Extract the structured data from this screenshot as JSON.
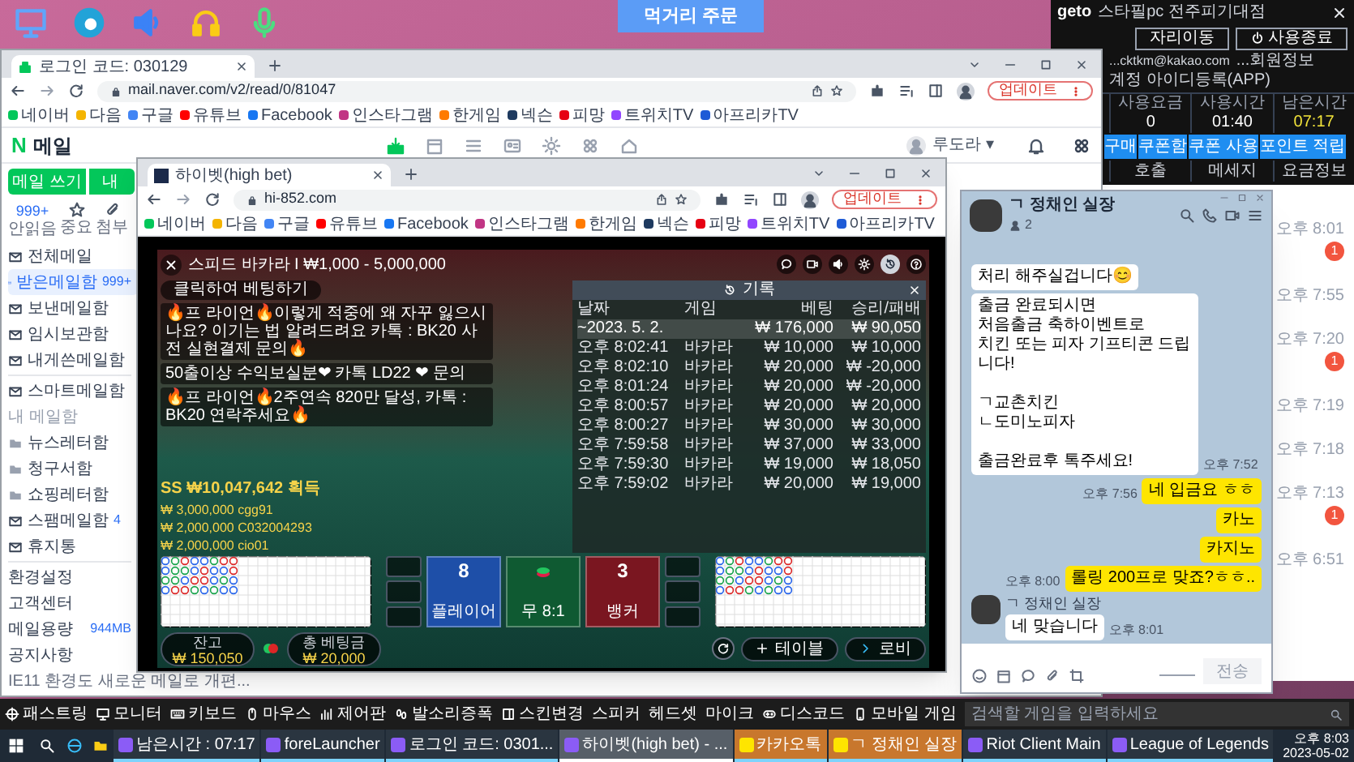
{
  "desktop_button": "먹거리 주문",
  "geto": {
    "logo": "geto",
    "title": "스타필pc 전주피기대점",
    "buttons": [
      "자리이동",
      "사용종료"
    ],
    "account": "...cktkm@kakao.com",
    "links": [
      "...회원정보",
      "계정 아이디등록(APP)"
    ],
    "stats": [
      {
        "label": "사용요금",
        "value": "0",
        "highlight": false
      },
      {
        "label": "사용시간",
        "value": "01:40",
        "highlight": false
      },
      {
        "label": "남은시간",
        "value": "07:17",
        "highlight": true
      }
    ],
    "actions": [
      "구매",
      "쿠폰함",
      "쿠폰 사용",
      "포인트 적립"
    ],
    "tabs": [
      "호출",
      "메세지",
      "요금정보"
    ]
  },
  "kakao_list": [
    {
      "time": "오후 8:01",
      "unread": "1"
    },
    {
      "time": "오후 7:55"
    },
    {
      "time": "오후 7:20",
      "unread": "1"
    },
    {
      "time": "오후 7:19"
    },
    {
      "time": "오후 7:18"
    },
    {
      "time": "오후 7:13",
      "unread": "1"
    },
    {
      "time": "오후 6:51"
    }
  ],
  "mail_browser": {
    "tab": "로그인 코드: 030129",
    "url": "mail.naver.com/v2/read/0/81047",
    "update_button": "업데이트",
    "bookmarks": [
      {
        "label": "네이버",
        "color": "#03c75a"
      },
      {
        "label": "다음",
        "color": "#f4b400"
      },
      {
        "label": "구글",
        "color": "#4285f4"
      },
      {
        "label": "유튜브",
        "color": "#ff0000"
      },
      {
        "label": "Facebook",
        "color": "#1877f2"
      },
      {
        "label": "인스타그램",
        "color": "#c13584"
      },
      {
        "label": "한게임",
        "color": "#ff7a00"
      },
      {
        "label": "넥슨",
        "color": "#1e3a5f"
      },
      {
        "label": "피망",
        "color": "#e60012"
      },
      {
        "label": "트위치TV",
        "color": "#9146ff"
      },
      {
        "label": "아프리카TV",
        "color": "#1f5bd6"
      }
    ],
    "logo": "N",
    "app_title": "메일",
    "user": "루도라 ▾",
    "compose_button": "메일 쓰기",
    "second_button": "내",
    "quick": [
      {
        "count": "999+",
        "label": "안읽음"
      },
      {
        "label": "중요"
      },
      {
        "label": "첨부"
      }
    ],
    "folders": [
      {
        "kind": "mailbox",
        "label": "전체메일",
        "selected": false
      },
      {
        "kind": "mailbox",
        "label": "받은메일함",
        "count": "999+",
        "selected": true
      },
      {
        "kind": "mailbox",
        "label": "보낸메일함",
        "selected": false
      },
      {
        "kind": "mailbox",
        "label": "임시보관함",
        "selected": false
      },
      {
        "kind": "mailbox",
        "label": "내게쓴메일함",
        "selected": false
      },
      {
        "kind": "mailbox",
        "label": "스마트메일함",
        "selected": false
      },
      {
        "kind": "header",
        "label": "내 메일함",
        "selected": false
      },
      {
        "kind": "folder",
        "label": "뉴스레터함",
        "selected": false
      },
      {
        "kind": "folder",
        "label": "청구서함",
        "selected": false
      },
      {
        "kind": "folder",
        "label": "쇼핑레터함",
        "selected": false
      },
      {
        "kind": "mailbox",
        "label": "스팸메일함",
        "count": "4",
        "selected": false
      },
      {
        "kind": "mailbox",
        "label": "휴지통",
        "selected": false
      },
      {
        "kind": "link",
        "label": "환경설정",
        "selected": false
      },
      {
        "kind": "link",
        "label": "고객센터",
        "selected": false
      },
      {
        "kind": "usage",
        "label": "메일용량",
        "value": "944MB",
        "selected": false
      },
      {
        "kind": "link",
        "label": "공지사항",
        "selected": false
      },
      {
        "kind": "notice",
        "label": "IE11 환경도 새로운 메일로 개편...",
        "selected": false
      }
    ]
  },
  "game_browser": {
    "tab": "하이벳(high bet)",
    "url": "hi-852.com",
    "update_button": "업데이트",
    "bookmarks": [
      {
        "label": "네이버",
        "color": "#03c75a"
      },
      {
        "label": "다음",
        "color": "#f4b400"
      },
      {
        "label": "구글",
        "color": "#4285f4"
      },
      {
        "label": "유튜브",
        "color": "#ff0000"
      },
      {
        "label": "Facebook",
        "color": "#1877f2"
      },
      {
        "label": "인스타그램",
        "color": "#c13584"
      },
      {
        "label": "한게임",
        "color": "#ff7a00"
      },
      {
        "label": "넥슨",
        "color": "#1e3a5f"
      },
      {
        "label": "피망",
        "color": "#e60012"
      },
      {
        "label": "트위치TV",
        "color": "#9146ff"
      },
      {
        "label": "아프리카TV",
        "color": "#1f5bd6"
      }
    ],
    "game": {
      "title": "스피드 바카라 I ₩1,000 - 5,000,000",
      "bet_prompt": "클릭하여 베팅하기",
      "chat": [
        "🔥프 라이언🔥이렇게 적중에 왜 자꾸 잃으시나요? 이기는 법 알려드려요 카톡 : BK20 사전 실현결제 문의🔥",
        "50출이상 수익보실분❤ 카톡 LD22 ❤ 문의",
        "🔥프 라이언🔥2주연속 820만 달성, 카톡 : BK20 연락주세요🔥"
      ],
      "history": {
        "title": "기록",
        "columns": [
          "날짜",
          "게임",
          "베팅",
          "승리/패배"
        ],
        "rows": [
          {
            "kind": "summary",
            "cells": [
              "~2023. 5. 2.",
              "",
              "₩ 176,000",
              "₩ 90,050"
            ]
          },
          {
            "kind": "entry",
            "cells": [
              "오후 8:02:41",
              "바카라",
              "₩ 10,000",
              "₩ 10,000"
            ]
          },
          {
            "kind": "entry",
            "cells": [
              "오후 8:02:10",
              "바카라",
              "₩ 20,000",
              "₩ -20,000"
            ]
          },
          {
            "kind": "entry",
            "cells": [
              "오후 8:01:24",
              "바카라",
              "₩ 20,000",
              "₩ -20,000"
            ]
          },
          {
            "kind": "entry",
            "cells": [
              "오후 8:00:57",
              "바카라",
              "₩ 20,000",
              "₩ 20,000"
            ]
          },
          {
            "kind": "entry",
            "cells": [
              "오후 8:00:27",
              "바카라",
              "₩ 30,000",
              "₩ 30,000"
            ]
          },
          {
            "kind": "entry",
            "cells": [
              "오후 7:59:58",
              "바카라",
              "₩ 37,000",
              "₩ 33,000"
            ]
          },
          {
            "kind": "entry",
            "cells": [
              "오후 7:59:30",
              "바카라",
              "₩ 19,000",
              "₩ 18,050"
            ]
          },
          {
            "kind": "entry",
            "cells": [
              "오후 7:59:02",
              "바카라",
              "₩ 20,000",
              "₩ 19,000"
            ]
          }
        ]
      },
      "winner": "SS ₩10,047,642 획득",
      "winners": [
        "₩ 3,000,000 cgg91",
        "₩ 2,000,000 C032004293",
        "₩ 2,000,000 cio01"
      ],
      "bet_spots": [
        {
          "label": "플레이어",
          "score": "8",
          "color": "#1e4fa8"
        },
        {
          "label": "무 8:1",
          "color": "#0f5a32"
        },
        {
          "label": "뱅커",
          "score": "3",
          "color": "#7a1620"
        }
      ],
      "balance": {
        "label": "잔고",
        "value": "₩ 150,050"
      },
      "total_bet": {
        "label": "총 베팅금",
        "value": "₩ 20,000"
      },
      "table_button": "테이블",
      "lobby_button": "로비"
    }
  },
  "chat": {
    "name": "ㄱ 정채인 실장",
    "members": "2",
    "send_button": "전송",
    "messages": [
      {
        "kind": "received",
        "text": "처리 해주실겁니다😊"
      },
      {
        "kind": "received",
        "text": "출금 완료되시면\n처음출금 축하이벤트로\n치킨 또는 피자 기프티콘 드립니다!\n\nㄱ교촌치킨\nㄴ도미노피자\n\n출금완료후 톡주세요!",
        "time": "오후 7:52"
      },
      {
        "kind": "sent",
        "text": "네 입금요 ㅎㅎ",
        "time": "오후 7:56"
      },
      {
        "kind": "sent",
        "text": "카노"
      },
      {
        "kind": "sent",
        "text": "카지노"
      },
      {
        "kind": "sent",
        "text": "롤링 200프로 맞죠?ㅎㅎ..",
        "time": "오후 8:00"
      },
      {
        "kind": "received",
        "sender": "ㄱ 정채인 실장",
        "text": "네 맞습니다",
        "time": "오후 8:01"
      }
    ]
  },
  "launcher": {
    "items": [
      "패스트링",
      "모니터",
      "키보드",
      "마우스",
      "제어판",
      "발소리증폭",
      "스킨변경",
      "스피커",
      "헤드셋",
      "마이크",
      "디스코드",
      "모바일 게임"
    ],
    "search_placeholder": "검색할 게임을 입력하세요"
  },
  "taskbar": {
    "items": [
      {
        "label": "남은시간 : 07:17",
        "selected": false,
        "flashing": false
      },
      {
        "label": "foreLauncher",
        "selected": false,
        "flashing": false
      },
      {
        "label": "로그인 코드: 0301...",
        "selected": false,
        "flashing": false
      },
      {
        "label": "하이벳(high bet) - ...",
        "selected": true,
        "flashing": false
      },
      {
        "label": "카카오톡",
        "selected": false,
        "flashing": true
      },
      {
        "label": "ㄱ 정채인 실장",
        "selected": false,
        "flashing": true
      },
      {
        "label": "Riot Client Main",
        "selected": false,
        "flashing": false
      },
      {
        "label": "League of Legends",
        "selected": false,
        "flashing": false
      }
    ],
    "time": "오후 8:03",
    "date": "2023-05-02"
  }
}
